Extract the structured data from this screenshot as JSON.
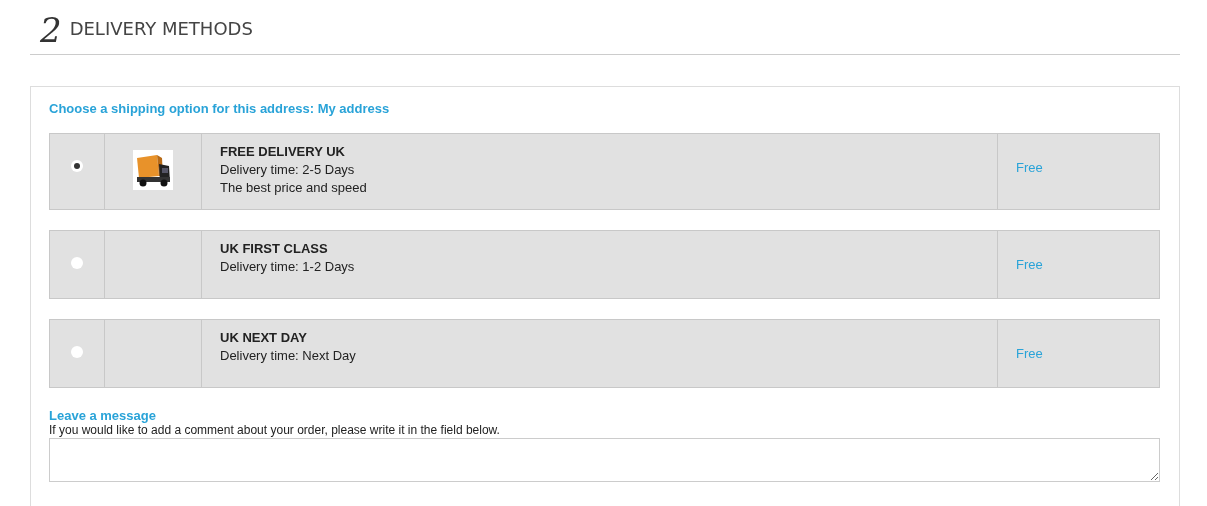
{
  "section": {
    "number": "2",
    "title": "DELIVERY METHODS"
  },
  "prompt": "Choose a shipping option for this address: My address",
  "options": [
    {
      "selected": true,
      "has_image": true,
      "name": "FREE DELIVERY UK",
      "lines": [
        "Delivery time: 2-5 Days",
        "The best price and speed"
      ],
      "price": "Free"
    },
    {
      "selected": false,
      "has_image": false,
      "name": "UK FIRST CLASS",
      "lines": [
        "Delivery time: 1-2 Days"
      ],
      "price": "Free"
    },
    {
      "selected": false,
      "has_image": false,
      "name": "UK NEXT DAY",
      "lines": [
        "Delivery time: Next Day"
      ],
      "price": "Free"
    }
  ],
  "message": {
    "title": "Leave a message",
    "hint": "If you would like to add a comment about your order, please write it in the field below."
  }
}
